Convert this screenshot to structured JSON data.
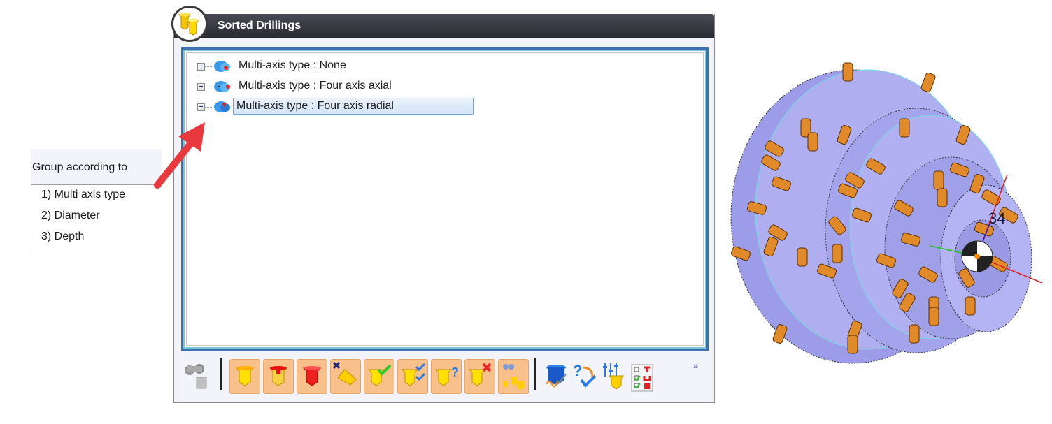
{
  "dialog": {
    "title": "Sorted Drillings",
    "logo_icon": "drilling-group-icon",
    "tree": [
      {
        "label": "Multi-axis type : None",
        "icon": "multi-axis-none-icon",
        "expanded": false,
        "selected": false
      },
      {
        "label": "Multi-axis type : Four axis axial",
        "icon": "multi-axis-axial-icon",
        "expanded": false,
        "selected": false
      },
      {
        "label": "Multi-axis type : Four axis radial",
        "icon": "multi-axis-radial-icon",
        "expanded": false,
        "selected": true
      }
    ],
    "toolbar": {
      "left_tool": "binoculars-icon",
      "buttons": [
        "drill-yellow-icon",
        "drill-red-top-icon",
        "drill-red-icon",
        "drill-remove-axis-icon",
        "drill-check-icon",
        "drill-double-check-icon",
        "drill-question-icon",
        "drill-delete-icon",
        "drill-group-icon"
      ],
      "right_tools": [
        "drill-edit-icon",
        "question-refresh-icon",
        "drill-settings-icon",
        "checklist-icon"
      ],
      "overflow": "»"
    }
  },
  "group_panel": {
    "title": "Group according to",
    "items": [
      "1) Multi axis type",
      "2) Diameter",
      "3) Depth"
    ]
  },
  "annotation": {
    "arrow_color": "#e8393f"
  },
  "model_view": {
    "label": "34",
    "body_color": "#a9a9ee",
    "drill_color": "#e08a2a"
  }
}
